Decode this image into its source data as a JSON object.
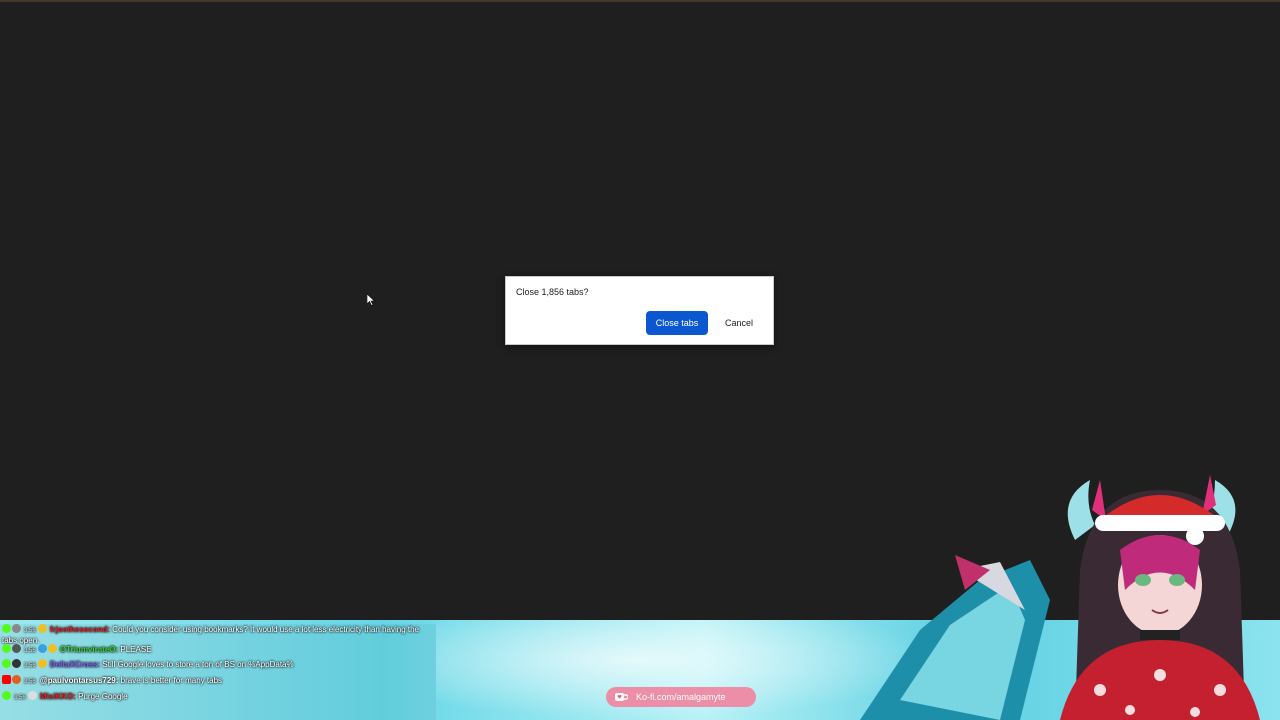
{
  "dialog": {
    "message": "Close 1,856 tabs?",
    "confirm_label": "Close tabs",
    "cancel_label": "Cancel"
  },
  "chat": {
    "messages": [
      {
        "user": "frjoethesecond:",
        "text": " Could you consider using bookmarks? It would use a lot less electricity than having the tabs open.",
        "user_color": "#e02020",
        "platform": "kick"
      },
      {
        "user": "OTriumvirateO:",
        "text": " PLEASE",
        "user_color": "#3cd23c",
        "platform": "kick"
      },
      {
        "user": "DeltaXCross:",
        "text": " Still Google loves to store a ton of BS on %AppData%",
        "user_color": "#8a5cf6",
        "platform": "kick"
      },
      {
        "user": "@paulvontarsus729:",
        "text": " brave is better for many tabs",
        "user_color": "#ffffff",
        "platform": "youtube"
      },
      {
        "user": "MisiKKO:",
        "text": " Purge Google",
        "user_color": "#e02020",
        "platform": "kick"
      }
    ],
    "timestamp": "3:56"
  },
  "kofi": {
    "label": "Ko-fi.com/amalgamyte"
  },
  "colors": {
    "background": "#1f1f1f",
    "primary_button": "#0b57d0",
    "kofi_pill": "#ec8ea8"
  }
}
